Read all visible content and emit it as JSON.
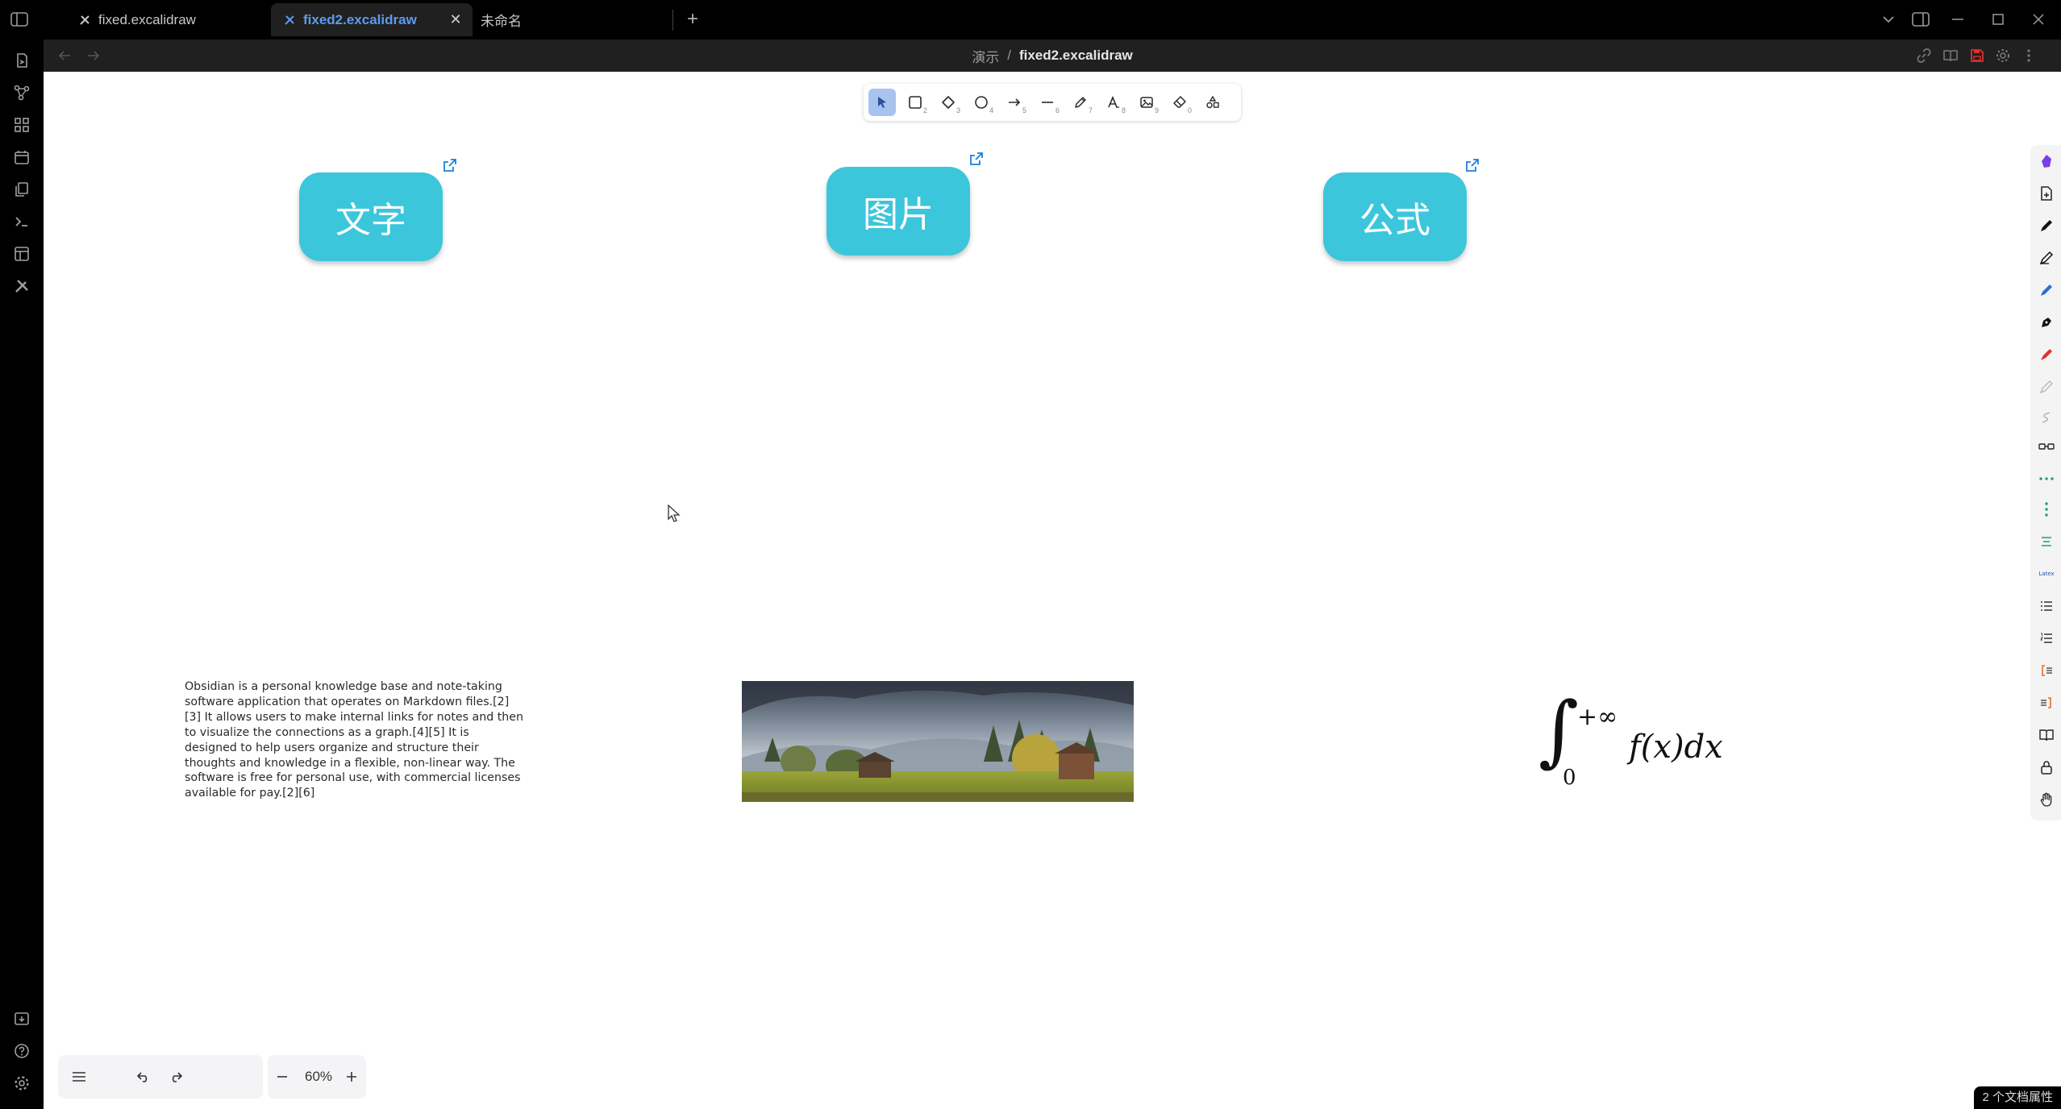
{
  "tabs": [
    {
      "label": "fixed.excalidraw",
      "active": false
    },
    {
      "label": "fixed2.excalidraw",
      "active": true
    },
    {
      "label": "未命名",
      "active": false
    }
  ],
  "breadcrumb": {
    "folder": "演示",
    "separator": "/",
    "file": "fixed2.excalidraw"
  },
  "cards": [
    {
      "label": "文字"
    },
    {
      "label": "图片"
    },
    {
      "label": "公式"
    }
  ],
  "paragraph": "Obsidian is a personal knowledge base and note-taking software application that operates on Markdown files.[2][3] It allows users to make internal links for notes and then to visualize the connections as a graph.[4][5] It is designed to help users organize and structure their thoughts and knowledge in a flexible, non-linear way. The software is free for personal use, with commercial licenses available for pay.[2][6]",
  "formula": {
    "upper": "+∞",
    "lower": "0",
    "body": "f(x)dx"
  },
  "toolbar": {
    "keys": [
      "2",
      "3",
      "4",
      "5",
      "6",
      "7",
      "8",
      "9",
      "0"
    ]
  },
  "zoom": {
    "label": "60%"
  },
  "status": {
    "text": "2 个文档属性"
  },
  "right_strip": {
    "latex_label": "Latex"
  },
  "colors": {
    "card": "#3cc6dc",
    "accent": "#5b9bf0",
    "active_tool": "#a9c3ef"
  }
}
